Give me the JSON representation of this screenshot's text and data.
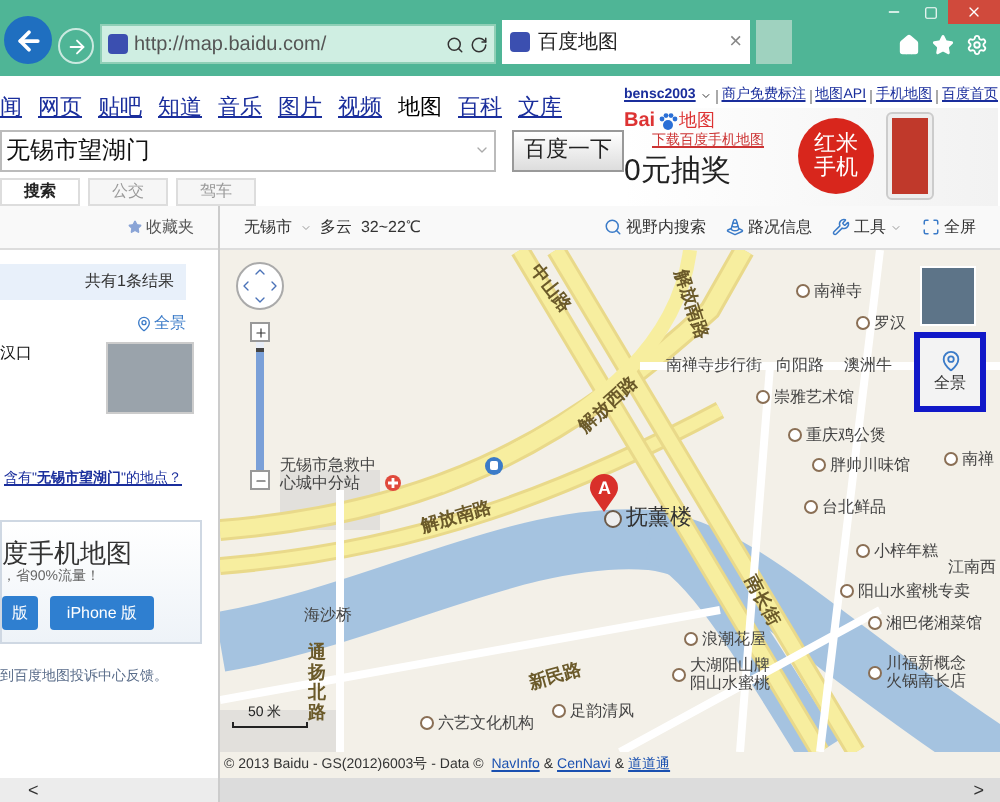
{
  "browser": {
    "url": "http://map.baidu.com/",
    "tab_title": "百度地图",
    "tab_close": "×"
  },
  "nav": {
    "links": [
      {
        "label": "闻",
        "selected": false
      },
      {
        "label": "网页",
        "selected": false
      },
      {
        "label": "贴吧",
        "selected": false
      },
      {
        "label": "知道",
        "selected": false
      },
      {
        "label": "音乐",
        "selected": false
      },
      {
        "label": "图片",
        "selected": false
      },
      {
        "label": "视频",
        "selected": false
      },
      {
        "label": "地图",
        "selected": true
      },
      {
        "label": "百科",
        "selected": false
      },
      {
        "label": "文库",
        "selected": false
      }
    ],
    "user": "bensc2003",
    "top_links": [
      "商户免费标注",
      "地图API",
      "手机地图",
      "百度首页"
    ]
  },
  "search": {
    "value": "无锡市望湖门",
    "button": "百度一下",
    "modes": [
      {
        "label": "搜索",
        "selected": true
      },
      {
        "label": "公交",
        "selected": false
      },
      {
        "label": "驾车",
        "selected": false
      }
    ]
  },
  "ad": {
    "logo_a": "Bai",
    "logo_b": "地图",
    "link": "下载百度手机地图",
    "headline": "0元抽奖",
    "badge_lines": [
      "红米",
      "手机"
    ]
  },
  "sidebar": {
    "favorites": "收藏夹",
    "result_count": "共有1条结果",
    "panorama": "全景",
    "result_text": "汉口",
    "question_link": "含有\"**无锡市望湖门**\"的地点？",
    "promo_title": "度手机地图",
    "promo_sub": "，省90%流量！",
    "promo_buttons": [
      "版",
      "iPhone 版"
    ],
    "feedback": "到百度地图投诉中心反馈。",
    "collapse": "<"
  },
  "map": {
    "city": "无锡市",
    "weather": "多云  32~22℃",
    "tools": [
      {
        "label": "视野内搜索",
        "kind": "search"
      },
      {
        "label": "路况信息",
        "kind": "traffic"
      },
      {
        "label": "工具",
        "kind": "tools"
      },
      {
        "label": "全屏",
        "kind": "fullscreen"
      }
    ],
    "panorama": {
      "label": "全景",
      "selected": true
    },
    "marker": "A",
    "zoom": {
      "level": 0.95
    },
    "scale": "50 米",
    "copyright": "© 2013 Baidu - GS(2012)6003号 - Data © ",
    "credits": [
      "NavInfo",
      "CenNavi",
      "道道通"
    ],
    "credit_separator": "&",
    "scroll_right": ">",
    "labels": [
      {
        "text": "无锡市急救中心城中分站",
        "kind": "place"
      },
      {
        "text": "解放南路",
        "kind": "road"
      },
      {
        "text": "解放南路",
        "kind": "road"
      },
      {
        "text": "解放西路",
        "kind": "road"
      },
      {
        "text": "中山路",
        "kind": "road"
      },
      {
        "text": "南禅寺",
        "kind": "poi"
      },
      {
        "text": "罗汉",
        "kind": "poi"
      },
      {
        "text": "南禅寺步行街",
        "kind": "place"
      },
      {
        "text": "向阳路",
        "kind": "place"
      },
      {
        "text": "澳洲牛",
        "kind": "place"
      },
      {
        "text": "崇雅艺术馆",
        "kind": "poi"
      },
      {
        "text": "重庆鸡公煲",
        "kind": "poi"
      },
      {
        "text": "胖帅川味馆",
        "kind": "poi"
      },
      {
        "text": "南禅",
        "kind": "poi"
      },
      {
        "text": "台北鲜品",
        "kind": "poi"
      },
      {
        "text": "小梓年糕",
        "kind": "poi"
      },
      {
        "text": "江南西",
        "kind": "place"
      },
      {
        "text": "阳山水蜜桃专卖",
        "kind": "poi"
      },
      {
        "text": "湘巴佬湘菜馆",
        "kind": "poi"
      },
      {
        "text": "浪潮花屋",
        "kind": "poi"
      },
      {
        "text": "大湖阳山牌阳山水蜜桃",
        "kind": "poi"
      },
      {
        "text": "川福新概念火锅南长店",
        "kind": "poi"
      },
      {
        "text": "新民路",
        "kind": "road"
      },
      {
        "text": "足韵清风",
        "kind": "poi"
      },
      {
        "text": "南长街",
        "kind": "road"
      },
      {
        "text": "海沙桥",
        "kind": "place"
      },
      {
        "text": "通扬北路",
        "kind": "road"
      },
      {
        "text": "六艺文化机构",
        "kind": "poi"
      },
      {
        "text": "抚薰楼",
        "kind": "landmark"
      }
    ]
  }
}
